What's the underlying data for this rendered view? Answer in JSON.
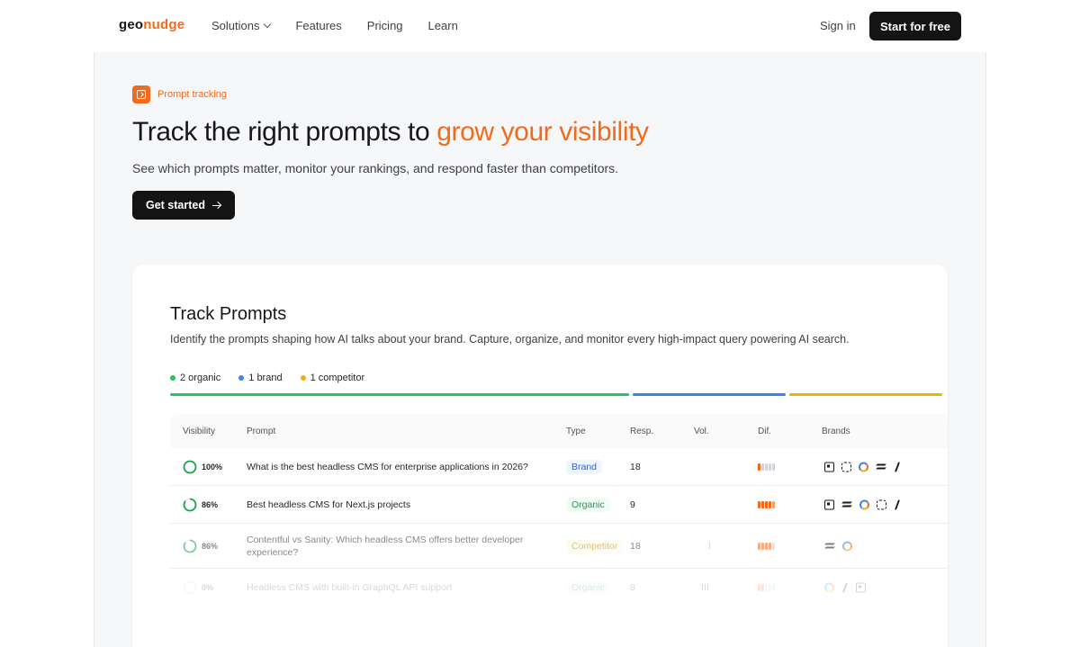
{
  "nav": {
    "logo_part1": "geo",
    "logo_part2": "nudge",
    "links": [
      "Solutions",
      "Features",
      "Pricing",
      "Learn"
    ],
    "signin": "Sign in",
    "cta": "Start for free"
  },
  "hero": {
    "badge": "Prompt tracking",
    "headline_plain": "Track the right prompts to ",
    "headline_highlight": "grow your visibility",
    "subtitle": "See which prompts matter, monitor your rankings, and respond faster than competitors.",
    "cta": "Get started"
  },
  "card": {
    "title": "Track Prompts",
    "description": "Identify the prompts shaping how AI talks about your brand. Capture, organize, and monitor every high-impact query powering AI search.",
    "legend": [
      {
        "label": "2 organic",
        "color": "#22c55e"
      },
      {
        "label": "1 brand",
        "color": "#3b82f6"
      },
      {
        "label": "1 competitor",
        "color": "#eab308"
      }
    ],
    "table": {
      "headers": [
        "Visibility",
        "Prompt",
        "Type",
        "Resp.",
        "Vol.",
        "Dif.",
        "Brands"
      ],
      "rows": [
        {
          "visibility": "100%",
          "prompt": "What is the best headless CMS for enterprise applications in 2026?",
          "type": "Brand",
          "resp": "18",
          "vol": "",
          "dif_level": 1
        },
        {
          "visibility": "86%",
          "prompt": "Best headless CMS for Next.js projects",
          "type": "Organic",
          "resp": "9",
          "vol": "",
          "dif_level": 4
        },
        {
          "visibility": "86%",
          "prompt": "Contentful vs Sanity: Which headless CMS offers better developer experience?",
          "type": "Competitor",
          "resp": "18",
          "vol": "I",
          "dif_level": 4
        },
        {
          "visibility": "0%",
          "prompt": "Headless CMS with built-in GraphQL API support",
          "type": "Organic",
          "resp": "8",
          "vol": "III",
          "dif_level": 2
        }
      ]
    }
  },
  "colors": {
    "accent": "#f26b1d",
    "organic": "#22c55e",
    "brand": "#3b82f6",
    "competitor": "#eab308"
  }
}
